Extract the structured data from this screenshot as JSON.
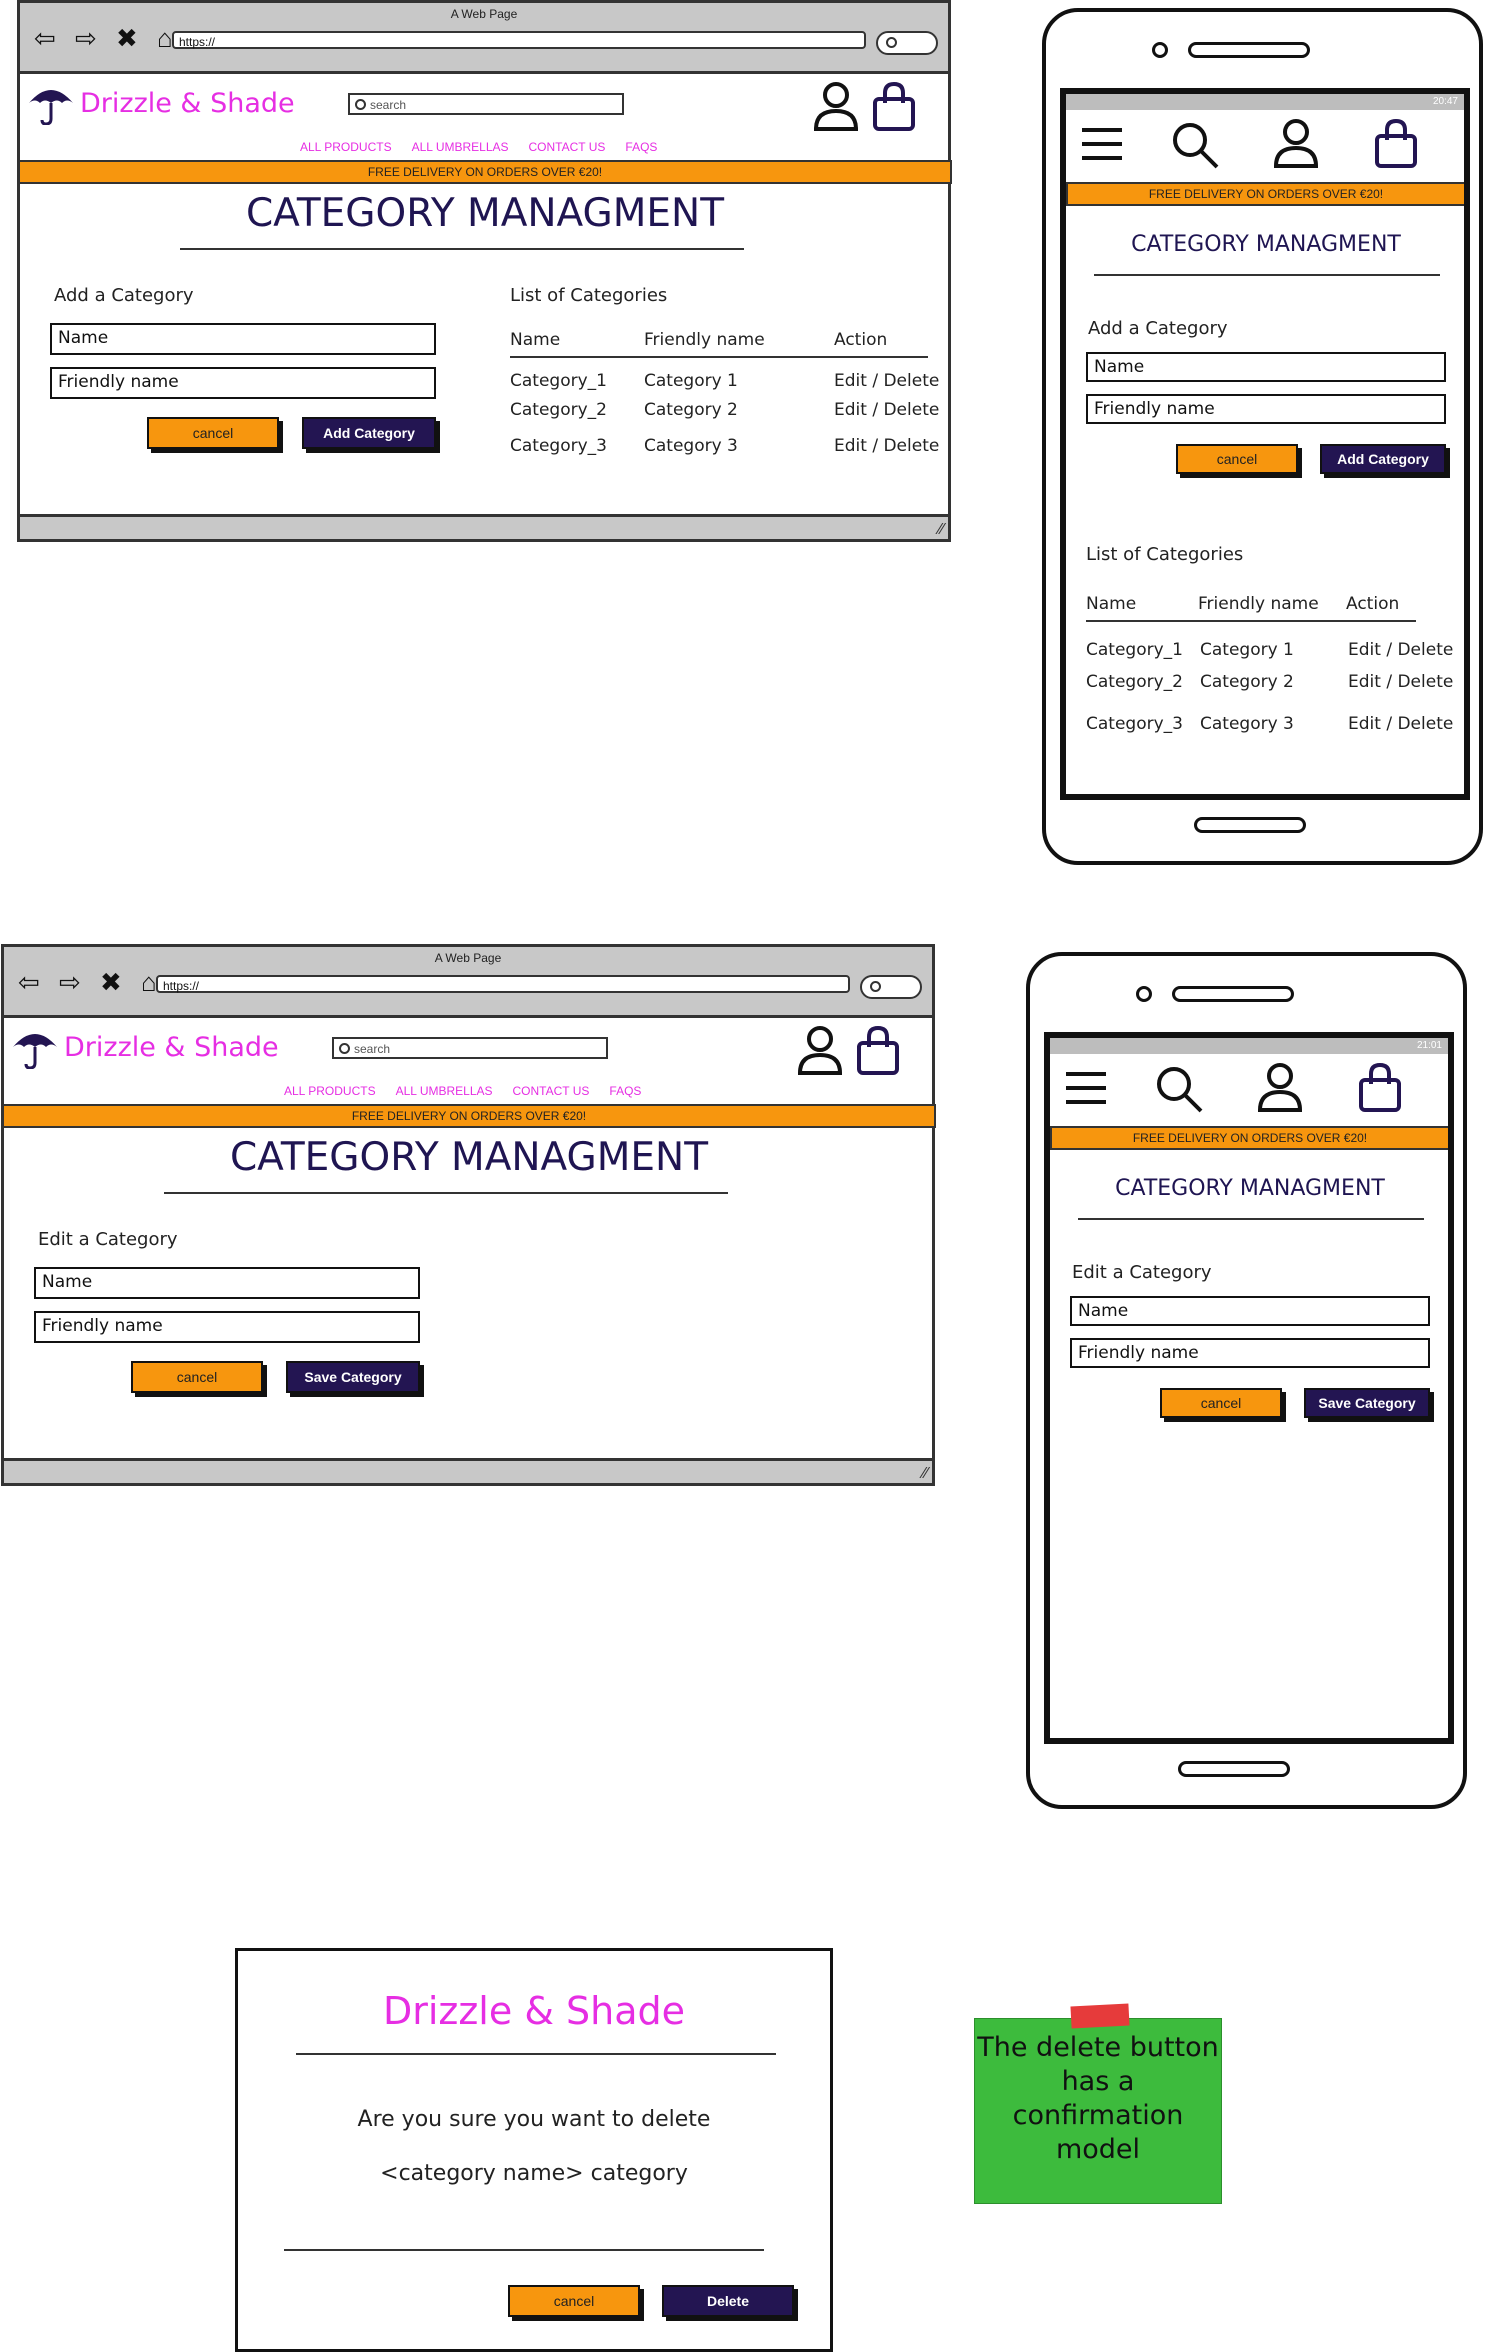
{
  "browser": {
    "window_title": "A Web Page",
    "url": "https://",
    "nav_icons": "⇦ ⇨ ✖ ⌂"
  },
  "site": {
    "brand": "Drizzle & Shade",
    "search_placeholder": "search",
    "nav": [
      "ALL PRODUCTS",
      "ALL UMBRELLAS",
      "CONTACT US",
      "FAQS"
    ],
    "banner": "FREE DELIVERY ON ORDERS OVER €20!"
  },
  "page_title": "CATEGORY MANAGMENT",
  "add_form": {
    "heading": "Add a Category",
    "name_placeholder": "Name",
    "friendly_placeholder": "Friendly name",
    "cancel": "cancel",
    "submit": "Add Category"
  },
  "edit_form": {
    "heading": "Edit a Category",
    "name_placeholder": "Name",
    "friendly_placeholder": "Friendly name",
    "cancel": "cancel",
    "submit": "Save Category"
  },
  "list": {
    "heading": "List of Categories",
    "columns": [
      "Name",
      "Friendly name",
      "Action"
    ],
    "rows": [
      {
        "name": "Category_1",
        "friendly": "Category 1",
        "action": "Edit / Delete"
      },
      {
        "name": "Category_2",
        "friendly": "Category 2",
        "action": "Edit / Delete"
      },
      {
        "name": "Category_3",
        "friendly": "Category 3",
        "action": "Edit / Delete"
      }
    ]
  },
  "phone": {
    "time_1": "20:47",
    "time_2": "21:01"
  },
  "modal": {
    "brand": "Drizzle & Shade",
    "line1": "Are you sure you want to delete",
    "line2": "<category name> category",
    "cancel": "cancel",
    "delete": "Delete"
  },
  "sticky_note": {
    "lines": [
      "The delete button",
      "has a",
      "confirmation",
      "model"
    ]
  },
  "colors": {
    "brand_pink": "#e62ee3",
    "navy": "#231552",
    "orange": "#f7960e",
    "sticky_green": "#3dbb3d"
  }
}
